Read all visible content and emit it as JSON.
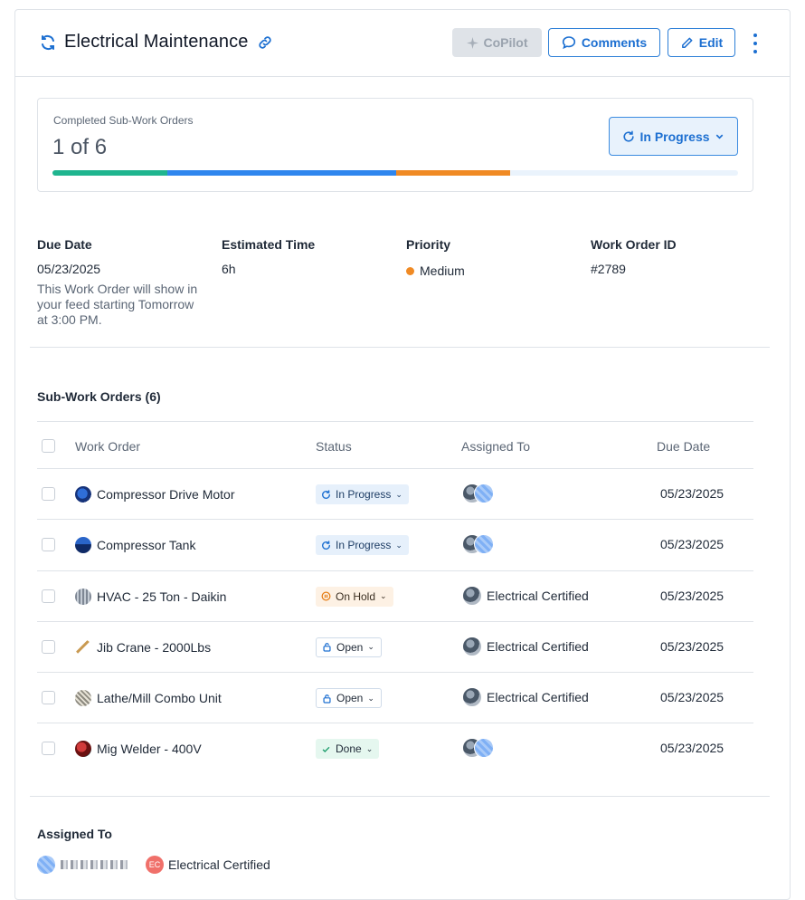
{
  "header": {
    "title": "Electrical Maintenance",
    "copilot_label": "CoPilot",
    "comments_label": "Comments",
    "edit_label": "Edit"
  },
  "progress": {
    "label": "Completed Sub-Work Orders",
    "count": "1 of 6",
    "status_label": "In Progress",
    "segments": [
      {
        "color": "#1fb58f",
        "fraction": 0.1667
      },
      {
        "color": "#2f86ee",
        "fraction": 0.3333
      },
      {
        "color": "#f08a24",
        "fraction": 0.1667
      }
    ]
  },
  "details": {
    "due_date_label": "Due Date",
    "due_date": "05/23/2025",
    "due_note": "This Work Order will show in your feed starting Tomorrow at 3:00 PM.",
    "est_time_label": "Estimated Time",
    "est_time": "6h",
    "priority_label": "Priority",
    "priority": "Medium",
    "priority_color": "#f08a24",
    "wo_id_label": "Work Order ID",
    "wo_id": "#2789"
  },
  "sub_work_orders": {
    "title": "Sub-Work Orders (6)",
    "columns": [
      "Work Order",
      "Status",
      "Assigned To",
      "Due Date"
    ],
    "rows": [
      {
        "name": "Compressor Drive Motor",
        "status": "In Progress",
        "assigned": "",
        "due": "05/23/2025"
      },
      {
        "name": "Compressor Tank",
        "status": "In Progress",
        "assigned": "",
        "due": "05/23/2025"
      },
      {
        "name": "HVAC - 25 Ton - Daikin",
        "status": "On Hold",
        "assigned": "Electrical Certified",
        "due": "05/23/2025"
      },
      {
        "name": "Jib Crane - 2000Lbs",
        "status": "Open",
        "assigned": "Electrical Certified",
        "due": "05/23/2025"
      },
      {
        "name": "Lathe/Mill Combo Unit",
        "status": "Open",
        "assigned": "Electrical Certified",
        "due": "05/23/2025"
      },
      {
        "name": "Mig Welder - 400V",
        "status": "Done",
        "assigned": "",
        "due": "05/23/2025"
      }
    ]
  },
  "assigned_to": {
    "label": "Assigned To",
    "team_initials": "EC",
    "team_name": "Electrical Certified"
  }
}
